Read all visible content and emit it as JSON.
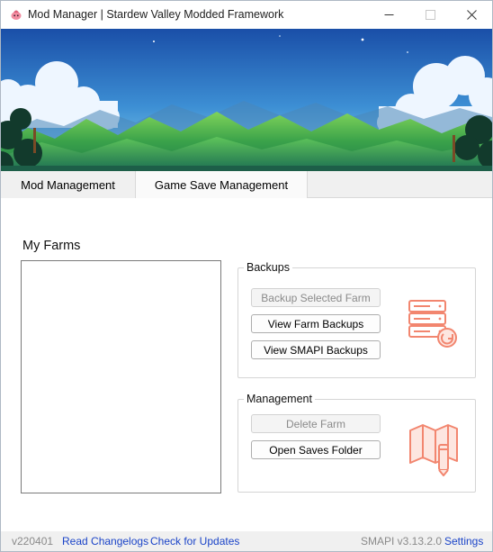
{
  "window": {
    "title": "Mod Manager | Stardew Valley Modded Framework"
  },
  "icons": {
    "app": "sdv-junimo-app-icon",
    "minimize": "minimize-icon",
    "maximize": "maximize-icon",
    "close": "close-icon",
    "backups": "database-restore-icon",
    "management": "map-edit-icon"
  },
  "colors": {
    "accent_icon": "#f2866f",
    "link": "#1b44c8",
    "sky_top": "#1a4fa8",
    "sky_bottom": "#6fc8e8",
    "hills": "#3ea84a"
  },
  "tabs": [
    {
      "label": "Mod Management",
      "active": false
    },
    {
      "label": "Game Save Management",
      "active": true
    }
  ],
  "farms": {
    "title": "My Farms",
    "items": []
  },
  "backups": {
    "group_title": "Backups",
    "backup_selected_label": "Backup Selected Farm",
    "view_farm_backups_label": "View Farm Backups",
    "view_smapi_backups_label": "View SMAPI Backups"
  },
  "management": {
    "group_title": "Management",
    "delete_farm_label": "Delete Farm",
    "open_saves_folder_label": "Open Saves Folder"
  },
  "status": {
    "version": "v220401",
    "changelog_link": "Read Changelogs",
    "updates_link": "Check for Updates",
    "smapi_version": "SMAPI v3.13.2.0",
    "settings_link": "Settings"
  }
}
